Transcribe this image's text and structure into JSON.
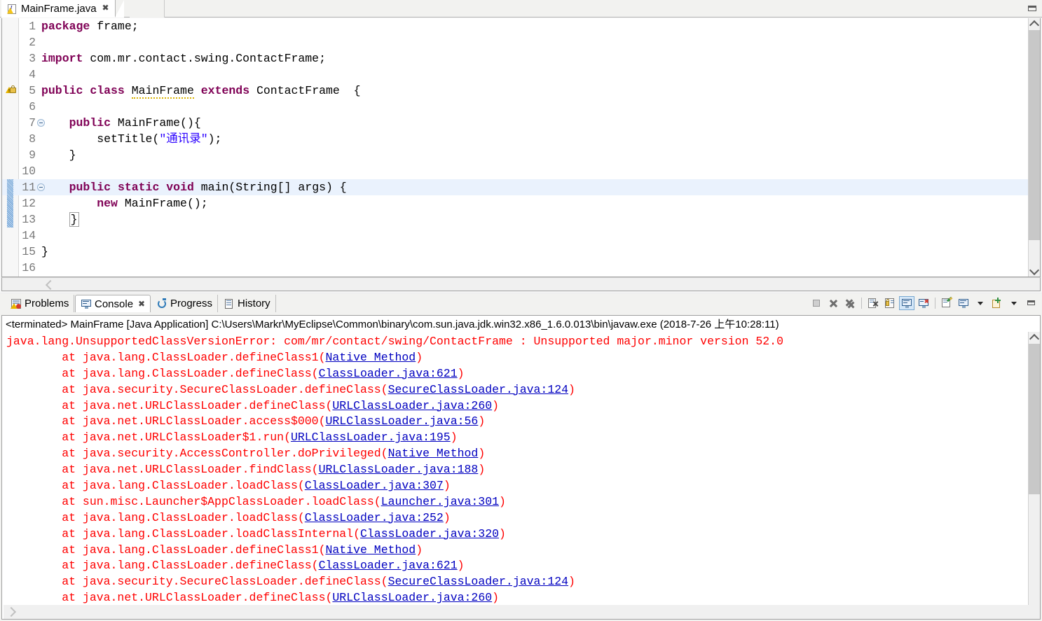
{
  "editor": {
    "tab": {
      "label": "MainFrame.java",
      "icon": "java-file-warning-icon",
      "close": "✖"
    },
    "minimize_label": "Minimize",
    "lines": [
      {
        "num": "1",
        "fold": false,
        "tokens": [
          {
            "t": "package",
            "c": "kw"
          },
          {
            "t": " frame;",
            "c": "plain"
          }
        ]
      },
      {
        "num": "2",
        "fold": false,
        "tokens": []
      },
      {
        "num": "3",
        "fold": false,
        "tokens": [
          {
            "t": "import",
            "c": "kw"
          },
          {
            "t": " com.mr.contact.swing.ContactFrame;",
            "c": "plain"
          }
        ]
      },
      {
        "num": "4",
        "fold": false,
        "tokens": []
      },
      {
        "num": "5",
        "fold": false,
        "marker": "warning",
        "tokens": [
          {
            "t": "public",
            "c": "kw"
          },
          {
            "t": " ",
            "c": "plain"
          },
          {
            "t": "class",
            "c": "kw"
          },
          {
            "t": " ",
            "c": "plain"
          },
          {
            "t": "MainFrame",
            "c": "warnline"
          },
          {
            "t": " ",
            "c": "plain"
          },
          {
            "t": "extends",
            "c": "kw"
          },
          {
            "t": " ContactFrame  {",
            "c": "plain"
          }
        ]
      },
      {
        "num": "6",
        "fold": false,
        "tokens": []
      },
      {
        "num": "7",
        "fold": true,
        "tokens": [
          {
            "t": "    ",
            "c": "plain"
          },
          {
            "t": "public",
            "c": "kw"
          },
          {
            "t": " MainFrame(){",
            "c": "plain"
          }
        ]
      },
      {
        "num": "8",
        "fold": false,
        "tokens": [
          {
            "t": "        setTitle(",
            "c": "plain"
          },
          {
            "t": "\"通讯录\"",
            "c": "str"
          },
          {
            "t": ");",
            "c": "plain"
          }
        ]
      },
      {
        "num": "9",
        "fold": false,
        "tokens": [
          {
            "t": "    }",
            "c": "plain"
          }
        ]
      },
      {
        "num": "10",
        "fold": false,
        "tokens": []
      },
      {
        "num": "11",
        "fold": true,
        "highlight": true,
        "change": true,
        "tokens": [
          {
            "t": "    ",
            "c": "plain"
          },
          {
            "t": "public",
            "c": "kw"
          },
          {
            "t": " ",
            "c": "plain"
          },
          {
            "t": "static",
            "c": "kw"
          },
          {
            "t": " ",
            "c": "plain"
          },
          {
            "t": "void",
            "c": "kw"
          },
          {
            "t": " main(String[] args) {",
            "c": "plain"
          }
        ]
      },
      {
        "num": "12",
        "fold": false,
        "change": true,
        "tokens": [
          {
            "t": "        ",
            "c": "plain"
          },
          {
            "t": "new",
            "c": "kw"
          },
          {
            "t": " MainFrame();",
            "c": "plain"
          }
        ]
      },
      {
        "num": "13",
        "fold": false,
        "change": true,
        "tokens": [
          {
            "t": "    ",
            "c": "plain"
          },
          {
            "t": "}",
            "c": "bracket"
          }
        ]
      },
      {
        "num": "14",
        "fold": false,
        "tokens": []
      },
      {
        "num": "15",
        "fold": false,
        "tokens": [
          {
            "t": "}",
            "c": "plain"
          }
        ]
      },
      {
        "num": "16",
        "fold": false,
        "tokens": []
      }
    ]
  },
  "console": {
    "tabs": [
      {
        "label": "Problems",
        "icon": "problems-icon",
        "active": false,
        "closeable": false
      },
      {
        "label": "Console",
        "icon": "console-icon",
        "active": true,
        "closeable": true,
        "close": "✖"
      },
      {
        "label": "Progress",
        "icon": "progress-icon",
        "active": false,
        "closeable": false
      },
      {
        "label": "History",
        "icon": "history-icon",
        "active": false,
        "closeable": false
      }
    ],
    "toolbar": [
      {
        "name": "terminate-button",
        "icon": "stop-square-icon",
        "enabled": false,
        "selected": false
      },
      {
        "name": "remove-launch-button",
        "icon": "remove-x-icon",
        "enabled": true,
        "selected": false
      },
      {
        "name": "remove-all-terminated-button",
        "icon": "remove-all-x-icon",
        "enabled": true,
        "selected": false
      },
      {
        "name": "separator-1",
        "icon": "separator",
        "enabled": false,
        "selected": false
      },
      {
        "name": "clear-console-button",
        "icon": "clear-console-icon",
        "enabled": true,
        "selected": false
      },
      {
        "name": "scroll-lock-button",
        "icon": "scroll-lock-icon",
        "enabled": true,
        "selected": false
      },
      {
        "name": "show-console-on-output-button",
        "icon": "show-console-icon",
        "enabled": true,
        "selected": true
      },
      {
        "name": "show-console-on-error-button",
        "icon": "show-console-error-icon",
        "enabled": true,
        "selected": false
      },
      {
        "name": "separator-2",
        "icon": "separator",
        "enabled": false,
        "selected": false
      },
      {
        "name": "pin-console-button",
        "icon": "pin-console-icon",
        "enabled": true,
        "selected": false
      },
      {
        "name": "display-selected-console-button",
        "icon": "display-console-icon",
        "enabled": true,
        "selected": false
      },
      {
        "name": "display-console-menu-button",
        "icon": "chevron-down-icon",
        "enabled": true,
        "selected": false
      },
      {
        "name": "open-console-button",
        "icon": "open-console-icon",
        "enabled": true,
        "selected": false
      },
      {
        "name": "open-console-menu-button",
        "icon": "chevron-down-icon",
        "enabled": true,
        "selected": false
      },
      {
        "name": "minimize-view-button",
        "icon": "minimize-icon",
        "enabled": true,
        "selected": false
      }
    ],
    "status_line": "<terminated> MainFrame [Java Application] C:\\Users\\Markr\\MyEclipse\\Common\\binary\\com.sun.java.jdk.win32.x86_1.6.0.013\\bin\\javaw.exe (2018-7-26 上午10:28:11)",
    "output_lines": [
      {
        "text": "java.lang.UnsupportedClassVersionError: com/mr/contact/swing/ContactFrame : Unsupported major.minor version 52.0",
        "link": null
      },
      {
        "text": "        at java.lang.ClassLoader.defineClass1(",
        "link": "Native Method",
        "tail": ")"
      },
      {
        "text": "        at java.lang.ClassLoader.defineClass(",
        "link": "ClassLoader.java:621",
        "tail": ")"
      },
      {
        "text": "        at java.security.SecureClassLoader.defineClass(",
        "link": "SecureClassLoader.java:124",
        "tail": ")"
      },
      {
        "text": "        at java.net.URLClassLoader.defineClass(",
        "link": "URLClassLoader.java:260",
        "tail": ")"
      },
      {
        "text": "        at java.net.URLClassLoader.access$000(",
        "link": "URLClassLoader.java:56",
        "tail": ")"
      },
      {
        "text": "        at java.net.URLClassLoader$1.run(",
        "link": "URLClassLoader.java:195",
        "tail": ")"
      },
      {
        "text": "        at java.security.AccessController.doPrivileged(",
        "link": "Native Method",
        "tail": ")"
      },
      {
        "text": "        at java.net.URLClassLoader.findClass(",
        "link": "URLClassLoader.java:188",
        "tail": ")"
      },
      {
        "text": "        at java.lang.ClassLoader.loadClass(",
        "link": "ClassLoader.java:307",
        "tail": ")"
      },
      {
        "text": "        at sun.misc.Launcher$AppClassLoader.loadClass(",
        "link": "Launcher.java:301",
        "tail": ")"
      },
      {
        "text": "        at java.lang.ClassLoader.loadClass(",
        "link": "ClassLoader.java:252",
        "tail": ")"
      },
      {
        "text": "        at java.lang.ClassLoader.loadClassInternal(",
        "link": "ClassLoader.java:320",
        "tail": ")"
      },
      {
        "text": "        at java.lang.ClassLoader.defineClass1(",
        "link": "Native Method",
        "tail": ")"
      },
      {
        "text": "        at java.lang.ClassLoader.defineClass(",
        "link": "ClassLoader.java:621",
        "tail": ")"
      },
      {
        "text": "        at java.security.SecureClassLoader.defineClass(",
        "link": "SecureClassLoader.java:124",
        "tail": ")"
      },
      {
        "text": "        at java.net.URLClassLoader.defineClass(",
        "link": "URLClassLoader.java:260",
        "tail": ")"
      }
    ]
  },
  "colors": {
    "error_text": "#ff0000",
    "link_text": "#0000c0",
    "keyword": "#7f0055",
    "string": "#2a00ff",
    "line_highlight": "#eaf2fd",
    "selected_toolbar": "#d4e7f8"
  }
}
